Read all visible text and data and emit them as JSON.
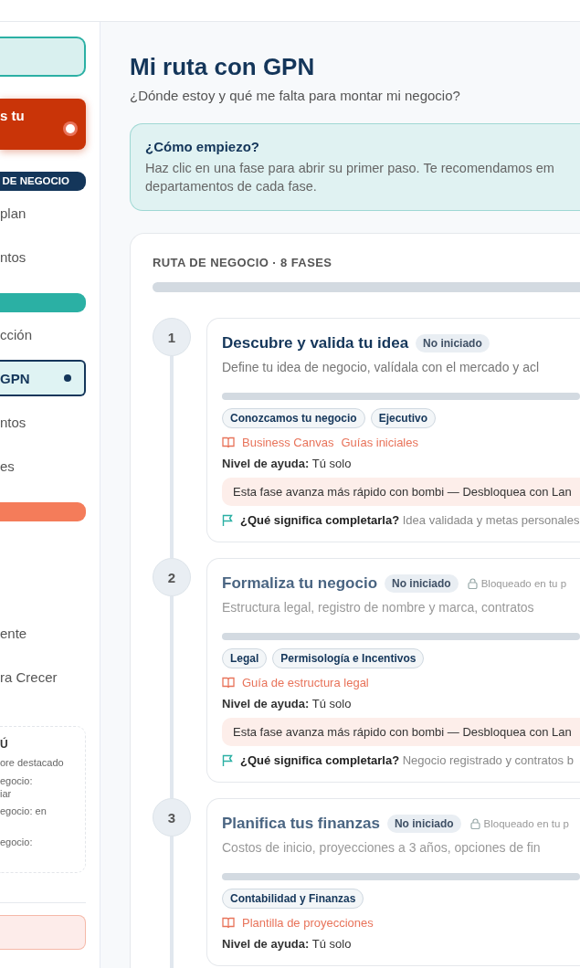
{
  "sidebar": {
    "primary_card": {
      "label": "s tu"
    },
    "groups": [
      {
        "heading": "DE NEGOCIO",
        "color": "#14365a",
        "items": [
          {
            "label": "plan",
            "selected": false
          },
          {
            "label": "ntos",
            "selected": false
          }
        ]
      },
      {
        "color": "#2bb0a4",
        "items": [
          {
            "label": "cción",
            "selected": false
          },
          {
            "label": "GPN",
            "selected": true
          },
          {
            "label": "ntos",
            "selected": false
          },
          {
            "label": "es",
            "selected": false
          }
        ]
      },
      {
        "color": "#f47c5a",
        "items": [
          {
            "label": "ente",
            "selected": false
          },
          {
            "label": "ra Crecer",
            "selected": false
          }
        ]
      }
    ],
    "info_card": {
      "title": "Ú",
      "lines": [
        "ore destacado",
        "egocio:",
        "iar",
        "egocio: en",
        "egocio:"
      ]
    }
  },
  "page": {
    "title": "Mi ruta con GPN",
    "subtitle": "¿Dónde estoy y qué me falta para montar mi negocio?"
  },
  "hint": {
    "title": "¿Cómo empiezo?",
    "lines": [
      "Haz clic en una fase para abrir su primer paso. Te recomendamos em",
      "departamentos de cada fase."
    ]
  },
  "route": {
    "heading": "RUTA DE NEGOCIO · 8 FASES",
    "level": 0,
    "phases": [
      {
        "number": "1",
        "title": "Descubre y valida tu idea",
        "status": "No iniciado",
        "locked": false,
        "description": "Define tu idea de negocio, valídala con el mercado y acl",
        "level": 0,
        "tags": [
          "Conozcamos tu negocio",
          "Ejecutivo"
        ],
        "resources": [
          "Business Canvas",
          "Guías iniciales"
        ],
        "help_label": "Nivel de ayuda:",
        "help_value": "Tú solo",
        "upsell": "Esta fase avanza más rápido con bombi — Desbloquea con Lan",
        "complete_label": "¿Qué significa completarla?",
        "complete_text": "Idea validada y metas personales"
      },
      {
        "number": "2",
        "title": "Formaliza tu negocio",
        "status": "No iniciado",
        "locked": true,
        "lock_text": "Bloqueado en tu p",
        "description": "Estructura legal, registro de nombre y marca, contratos",
        "level": 0,
        "tags": [
          "Legal",
          "Permisología e Incentivos"
        ],
        "resources": [
          "Guía de estructura legal"
        ],
        "help_label": "Nivel de ayuda:",
        "help_value": "Tú solo",
        "upsell": "Esta fase avanza más rápido con bombi — Desbloquea con Lan",
        "complete_label": "¿Qué significa completarla?",
        "complete_text": "Negocio registrado y contratos b"
      },
      {
        "number": "3",
        "title": "Planifica tus finanzas",
        "status": "No iniciado",
        "locked": true,
        "lock_text": "Bloqueado en tu p",
        "description": "Costos de inicio, proyecciones a 3 años, opciones de fin",
        "level": 0,
        "tags": [
          "Contabilidad y Finanzas"
        ],
        "resources": [
          "Plantilla de proyecciones"
        ],
        "help_label": "Nivel de ayuda:",
        "help_value": "Tú solo"
      }
    ]
  }
}
